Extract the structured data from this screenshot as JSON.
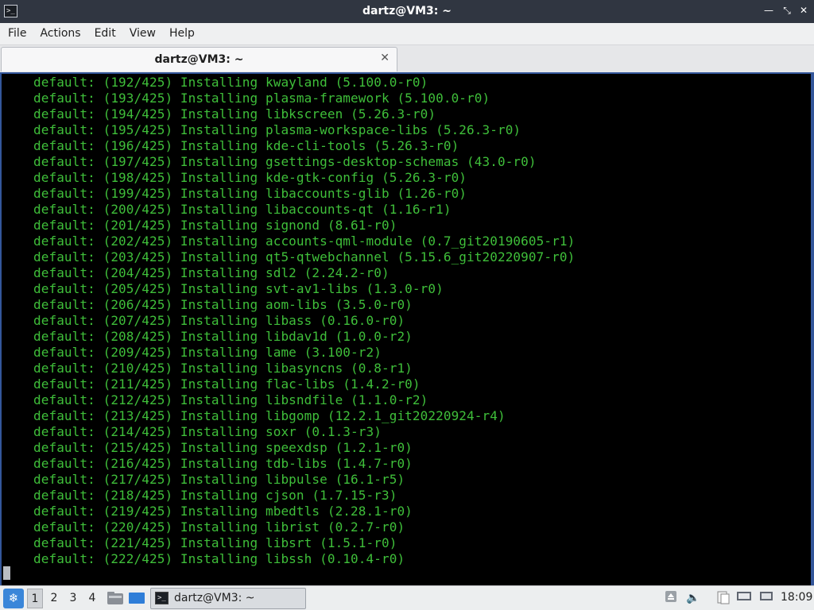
{
  "window": {
    "title": "dartz@VM3: ~",
    "controls": [
      "minimize",
      "maximize",
      "close"
    ]
  },
  "menubar": {
    "items": [
      "File",
      "Actions",
      "Edit",
      "View",
      "Help"
    ]
  },
  "tabs": [
    {
      "label": "dartz@VM3: ~",
      "active": true
    }
  ],
  "terminal": {
    "text_color": "#3fbf3a",
    "background": "#000000",
    "lines": [
      "default: (192/425) Installing kwayland (5.100.0-r0)",
      "default: (193/425) Installing plasma-framework (5.100.0-r0)",
      "default: (194/425) Installing libkscreen (5.26.3-r0)",
      "default: (195/425) Installing plasma-workspace-libs (5.26.3-r0)",
      "default: (196/425) Installing kde-cli-tools (5.26.3-r0)",
      "default: (197/425) Installing gsettings-desktop-schemas (43.0-r0)",
      "default: (198/425) Installing kde-gtk-config (5.26.3-r0)",
      "default: (199/425) Installing libaccounts-glib (1.26-r0)",
      "default: (200/425) Installing libaccounts-qt (1.16-r1)",
      "default: (201/425) Installing signond (8.61-r0)",
      "default: (202/425) Installing accounts-qml-module (0.7_git20190605-r1)",
      "default: (203/425) Installing qt5-qtwebchannel (5.15.6_git20220907-r0)",
      "default: (204/425) Installing sdl2 (2.24.2-r0)",
      "default: (205/425) Installing svt-av1-libs (1.3.0-r0)",
      "default: (206/425) Installing aom-libs (3.5.0-r0)",
      "default: (207/425) Installing libass (0.16.0-r0)",
      "default: (208/425) Installing libdav1d (1.0.0-r2)",
      "default: (209/425) Installing lame (3.100-r2)",
      "default: (210/425) Installing libasyncns (0.8-r1)",
      "default: (211/425) Installing flac-libs (1.4.2-r0)",
      "default: (212/425) Installing libsndfile (1.1.0-r2)",
      "default: (213/425) Installing libgomp (12.2.1_git20220924-r4)",
      "default: (214/425) Installing soxr (0.1.3-r3)",
      "default: (215/425) Installing speexdsp (1.2.1-r0)",
      "default: (216/425) Installing tdb-libs (1.4.7-r0)",
      "default: (217/425) Installing libpulse (16.1-r5)",
      "default: (218/425) Installing cjson (1.7.15-r3)",
      "default: (219/425) Installing mbedtls (2.28.1-r0)",
      "default: (220/425) Installing librist (0.2.7-r0)",
      "default: (221/425) Installing libsrt (1.5.1-r0)",
      "default: (222/425) Installing libssh (0.10.4-r0)"
    ]
  },
  "taskbar": {
    "workspaces": [
      "1",
      "2",
      "3",
      "4"
    ],
    "active_workspace": "1",
    "task_label": "dartz@VM3: ~",
    "clock": "18:09",
    "start_icon": "lxqt-start-icon",
    "quick_icons": [
      "file-manager-icon",
      "show-desktop-icon"
    ],
    "tray_icons": [
      "eject-icon",
      "volume-icon",
      "clipboard-icon",
      "network-icon"
    ]
  }
}
